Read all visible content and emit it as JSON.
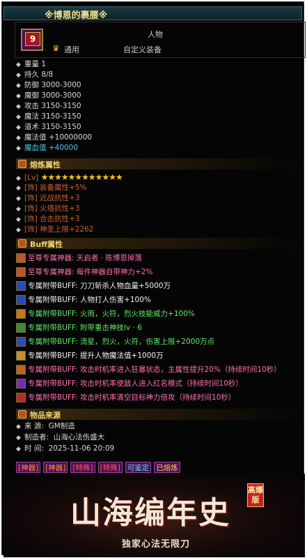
{
  "title": "※博恩的裹腰※",
  "header": {
    "level": "9",
    "category": "人物",
    "type": "通用",
    "custom": "自定义装备"
  },
  "stats": [
    {
      "label": "重量",
      "value": "1"
    },
    {
      "label": "持久",
      "value": "8/8"
    },
    {
      "label": "防御",
      "value": "3000-3000"
    },
    {
      "label": "魔御",
      "value": "3000-3000"
    },
    {
      "label": "攻击",
      "value": "3150-3150"
    },
    {
      "label": "魔法",
      "value": "3150-3150"
    },
    {
      "label": "道术",
      "value": "3150-3150"
    },
    {
      "label": "魔法值",
      "value": "+10000000"
    },
    {
      "label": "魔血值",
      "value": "+40000"
    }
  ],
  "forge": {
    "title": "熔炼属性",
    "lv_tag": "[Lv]",
    "stars": "★★★★★★★★★★★★",
    "rows": [
      {
        "tag": "[饰]",
        "text": "装备属性+5%"
      },
      {
        "tag": "[饰]",
        "text": "近战抗性+3"
      },
      {
        "tag": "[饰]",
        "text": "火墙抗性+3"
      },
      {
        "tag": "[饰]",
        "text": "合击抗性+3"
      },
      {
        "tag": "[饰]",
        "text": "神圣上限+2262"
      }
    ]
  },
  "buff": {
    "title": "Buff属性",
    "rows": [
      {
        "prefix": "至尊专属神器:",
        "text": "天启者 · 陈博恩掉落",
        "color": "#ff6fb0",
        "icon_color": "#b8582a"
      },
      {
        "prefix": "至尊专属神器:",
        "text": "每件神器自带神力+2%",
        "color": "#ff6fb0",
        "icon_color": "#b8582a"
      },
      {
        "prefix": "专属附带BUFF:",
        "text": "刀刀斩杀人物血量+5000万",
        "color": "#f0f0f0",
        "icon_color": "#2a4ab8"
      },
      {
        "prefix": "专属附带BUFF:",
        "text": "人物打人伤害+100%",
        "color": "#f0f0f0",
        "icon_color": "#2a4ab8"
      },
      {
        "prefix": "专属附带BUFF:",
        "text": "火雨，火符，烈火技能威力+100%",
        "color": "#5fe86a",
        "icon_color": "#c57a1a"
      },
      {
        "prefix": "专属附带BUFF:",
        "text": "附带重击神技lv · 6",
        "color": "#5fe86a",
        "icon_color": "#3a8a3a"
      },
      {
        "prefix": "专属附带BUFF:",
        "text": "流星，烈火，火符，伤害上限+2000万点",
        "color": "#5fe86a",
        "icon_color": "#2a4ab8"
      },
      {
        "prefix": "专属附带BUFF:",
        "text": "提升人物魔法值+1000万",
        "color": "#f5f5f5",
        "icon_color": "#c0902a"
      },
      {
        "prefix": "专属附带BUFF:",
        "text": "攻击时机率进入狂暴状态，主属性提升20%（持续时间10秒）",
        "color": "#ff6fb0",
        "icon_color": "#c0602a"
      },
      {
        "prefix": "专属附带BUFF:",
        "text": "攻击时机率使敌人进入红名模式（持续时间10秒）",
        "color": "#ff6fb0",
        "icon_color": "#7a2ab8"
      },
      {
        "prefix": "专属附带BUFF:",
        "text": "攻击时机率清空目标神力倍攻（持续时间10秒）",
        "color": "#ff6fb0",
        "icon_color": "#b82a2a"
      }
    ]
  },
  "source": {
    "title": "物品来源",
    "rows": [
      {
        "label": "来    源:",
        "value": "GM制造"
      },
      {
        "label": "制造者:",
        "value": "山海心法伤盛大"
      },
      {
        "label": "时    间:",
        "value": "2025-11-06 20:09"
      }
    ]
  },
  "tags": [
    {
      "text": "[神器]",
      "color": "#ff8a3c"
    },
    {
      "text": "[神器]",
      "color": "#ff8a3c"
    },
    {
      "text": "[特殊]",
      "color": "#ff5a5a"
    },
    {
      "text": "[特殊]",
      "color": "#ff5a5a"
    },
    {
      "text": "可鉴定",
      "color": "#4fe0ff"
    },
    {
      "text": "已熔炼",
      "color": "#ffd24a"
    }
  ],
  "banner": {
    "title": "山海编年史",
    "badge": "高爆版",
    "subtitle": "独家心法无限刀"
  }
}
